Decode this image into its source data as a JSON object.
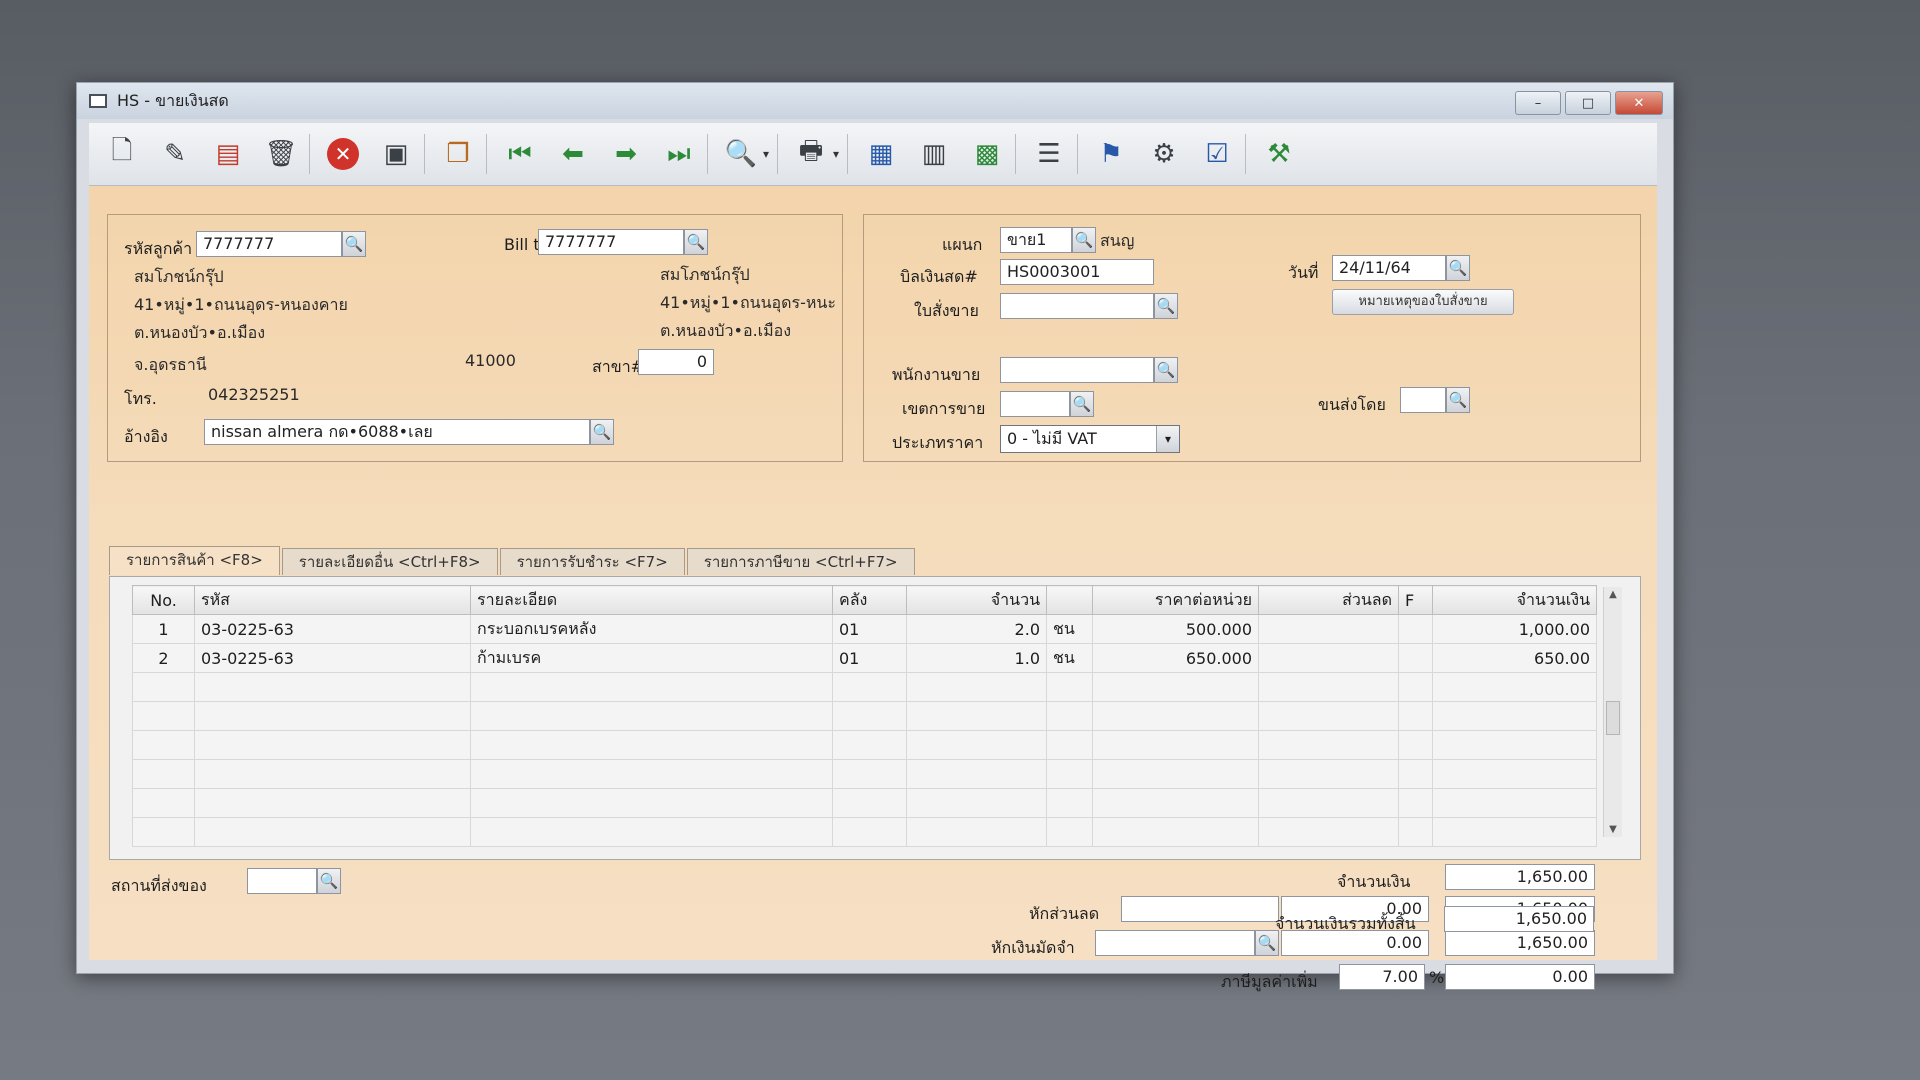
{
  "window": {
    "title": "HS - ขายเงินสด",
    "controls": [
      "–",
      "□",
      "✕"
    ]
  },
  "toolbar": {
    "icons": [
      "new-doc-icon",
      "edit-doc-icon",
      "void-doc-icon",
      "delete-icon",
      "cancel-icon",
      "save-icon",
      "copy-icon",
      "first-record-icon",
      "prev-record-icon",
      "next-record-icon",
      "last-record-icon",
      "search-record-icon",
      "print-icon",
      "calculator-icon",
      "register-icon",
      "so-import-icon",
      "report-icon",
      "approve-icon",
      "link-icon",
      "ok-icon",
      "settings-icon"
    ],
    "first_label": "First",
    "dropdown_glyph": "▾"
  },
  "customer": {
    "code_label": "รหัสลูกค้า",
    "code": "7777777",
    "name": "สมโภชน์กรุ๊ป",
    "address1": "41•หมู่•1•ถนนอุดร-หนองคาย",
    "address2": "ต.หนองบัว•อ.เมือง",
    "province": "จ.อุดรธานี",
    "postcode": "41000",
    "phone_label": "โทร.",
    "phone": "042325251",
    "ref_label": "อ้างอิง",
    "ref": "nissan almera กด•6088•เลย",
    "branch_label": "สาขา#",
    "branch": "0"
  },
  "bill_to": {
    "label": "Bill to",
    "code": "7777777",
    "name": "สมโภชน์กรุ๊ป",
    "address1": "41•หมู่•1•ถนนอุดร-หนะ",
    "address2": "ต.หนองบัว•อ.เมือง"
  },
  "doc": {
    "dept_label": "แผนก",
    "dept": "ขาย1",
    "dept_name": "สนญ",
    "bill_label": "บิลเงินสด#",
    "bill_no": "HS0003001",
    "date_label": "วันที่",
    "date": "24/11/64",
    "so_label": "ใบสั่งขาย",
    "so": "",
    "so_note_button": "หมายเหตุของใบสั่งขาย",
    "salesman_label": "พนักงานขาย",
    "salesman": "",
    "area_label": "เขตการขาย",
    "area": "",
    "ship_label": "ขนส่งโดย",
    "ship": "",
    "price_type_label": "ประเภทราคา",
    "price_type": "0 - ไม่มี VAT"
  },
  "tabs": [
    {
      "label": "รายการสินค้า <F8>",
      "active": true
    },
    {
      "label": "รายละเอียดอื่น <Ctrl+F8>",
      "active": false
    },
    {
      "label": "รายการรับชำระ <F7>",
      "active": false
    },
    {
      "label": "รายการภาษีขาย <Ctrl+F7>",
      "active": false
    }
  ],
  "grid": {
    "columns": [
      "No.",
      "รหัส",
      "รายละเอียด",
      "คลัง",
      "จำนวน",
      "",
      "ราคาต่อหน่วย",
      "ส่วนลด",
      "F",
      "จำนวนเงิน"
    ],
    "rows": [
      [
        "1",
        "03-0225-63",
        "กระบอกเบรคหลัง",
        "01",
        "2.0",
        "ชน",
        "500.000",
        "",
        "",
        "1,000.00"
      ],
      [
        "2",
        "03-0225-63",
        "ก้ามเบรค",
        "01",
        "1.0",
        "ชน",
        "650.000",
        "",
        "",
        "650.00"
      ],
      [
        "",
        "",
        "",
        "",
        "",
        "",
        "",
        "",
        "",
        ""
      ],
      [
        "",
        "",
        "",
        "",
        "",
        "",
        "",
        "",
        "",
        ""
      ],
      [
        "",
        "",
        "",
        "",
        "",
        "",
        "",
        "",
        "",
        ""
      ],
      [
        "",
        "",
        "",
        "",
        "",
        "",
        "",
        "",
        "",
        ""
      ],
      [
        "",
        "",
        "",
        "",
        "",
        "",
        "",
        "",
        "",
        ""
      ],
      [
        "",
        "",
        "",
        "",
        "",
        "",
        "",
        "",
        "",
        ""
      ]
    ]
  },
  "footer": {
    "delivery_label": "สถานที่ส่งของ",
    "delivery": "",
    "amount_label": "จำนวนเงิน",
    "amount": "1,650.00",
    "discount_label": "หักส่วนลด",
    "discount_input": "",
    "discount_value": "0.00",
    "after_discount": "1,650.00",
    "deposit_label": "หักเงินมัดจำ",
    "deposit_input": "",
    "deposit_value": "0.00",
    "after_deposit": "1,650.00",
    "vat_label": "ภาษีมูลค่าเพิ่ม",
    "vat_rate": "7.00",
    "vat_unit": "%",
    "vat_amount": "0.00",
    "total_label": "จำนวนเงินรวมทั้งสิ้น",
    "total": "1,650.00"
  }
}
